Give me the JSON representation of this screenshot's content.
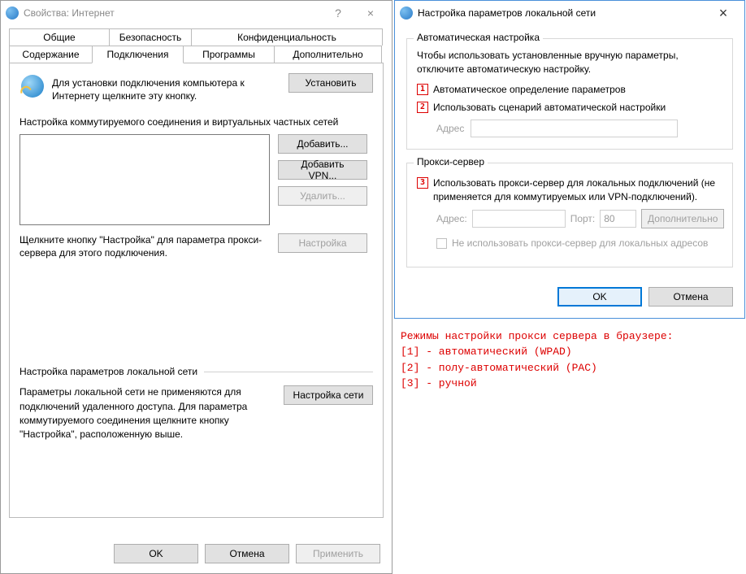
{
  "left": {
    "title": "Свойства: Интернет",
    "help": "?",
    "close": "×",
    "tabs_row1": [
      "Общие",
      "Безопасность",
      "Конфиденциальность"
    ],
    "tabs_row2": [
      "Содержание",
      "Подключения",
      "Программы",
      "Дополнительно"
    ],
    "active_tab": "Подключения",
    "install_text": "Для установки подключения компьютера к Интернету щелкните эту кнопку.",
    "install_btn": "Установить",
    "dial_label": "Настройка коммутируемого соединения и виртуальных частных сетей",
    "add_btn": "Добавить...",
    "add_vpn_btn": "Добавить VPN...",
    "delete_btn": "Удалить...",
    "settings_btn": "Настройка",
    "desc": "Щелкните кнопку \"Настройка\" для параметра прокси-сервера для этого подключения.",
    "lan_legend": "Настройка параметров локальной сети",
    "lan_text": "Параметры локальной сети не применяются для подключений удаленного доступа. Для параметра коммутируемого соединения щелкните кнопку \"Настройка\", расположенную выше.",
    "lan_btn": "Настройка сети",
    "ok": "OK",
    "cancel": "Отмена",
    "apply": "Применить"
  },
  "right": {
    "title": "Настройка параметров локальной сети",
    "close": "×",
    "auto_legend": "Автоматическая настройка",
    "auto_text": "Чтобы использовать установленные вручную параметры, отключите автоматическую настройку.",
    "m1": "1",
    "m2": "2",
    "m3": "3",
    "auto_detect": "Автоматическое определение параметров",
    "auto_script": "Использовать сценарий автоматической настройки",
    "addr_label": "Адрес",
    "proxy_legend": "Прокси-сервер",
    "proxy_use": "Использовать прокси-сервер для локальных подключений (не применяется для коммутируемых или VPN-подключений).",
    "addr2_label": "Адрес:",
    "port_label": "Порт:",
    "port_value": "80",
    "advanced": "Дополнительно",
    "bypass": "Не использовать прокси-сервер для локальных адресов",
    "ok": "OK",
    "cancel": "Отмена"
  },
  "annot": "Режимы настройки прокси сервера в браузере:\n[1] - автоматический (WPAD)\n[2] - полу-автоматический (PAC)\n[3] - ручной"
}
